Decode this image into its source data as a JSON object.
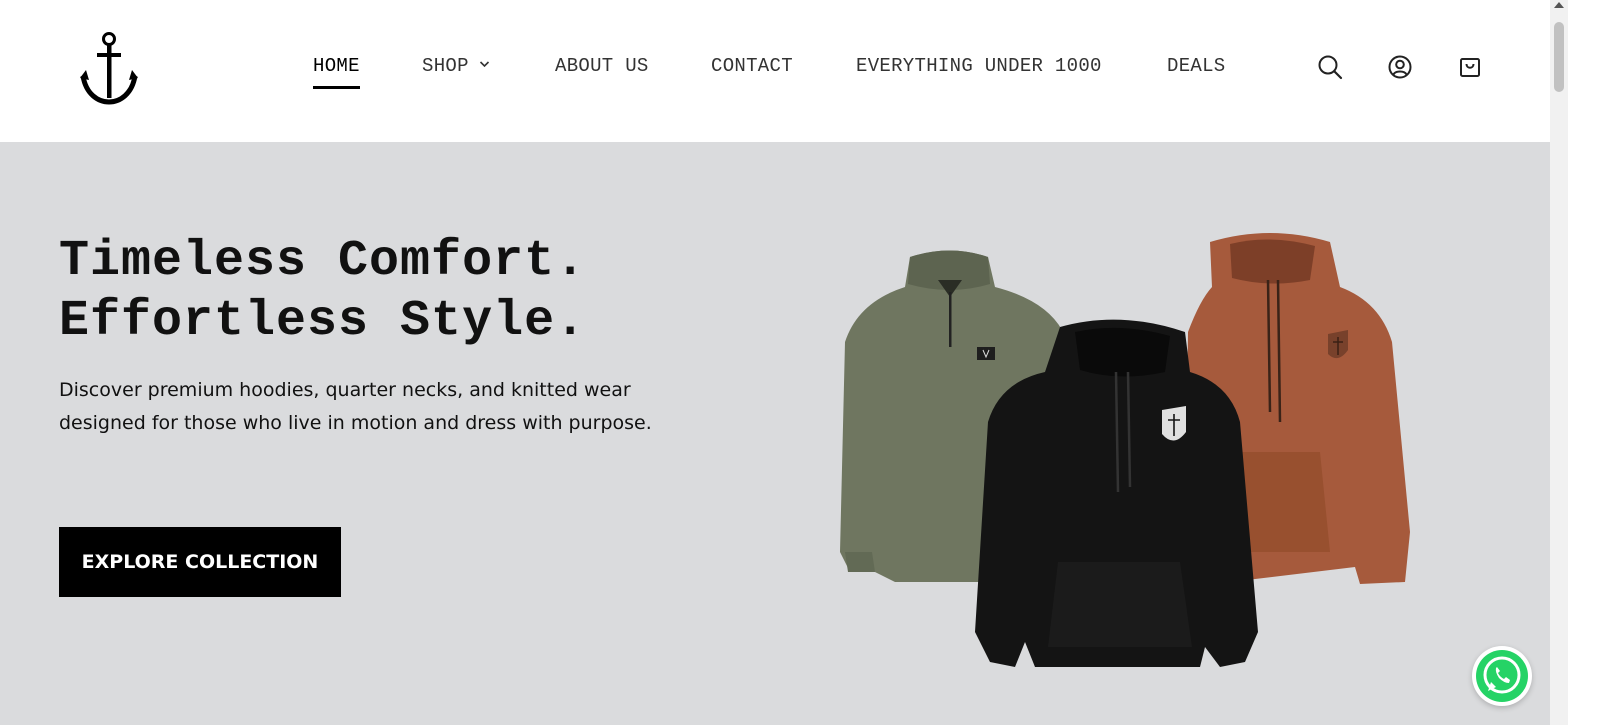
{
  "nav": {
    "items": [
      {
        "label": "HOME",
        "active": true
      },
      {
        "label": "SHOP",
        "has_dropdown": true
      },
      {
        "label": "ABOUT US"
      },
      {
        "label": "CONTACT"
      },
      {
        "label": "EVERYTHING UNDER 1000"
      },
      {
        "label": "DEALS"
      }
    ]
  },
  "header_icons": [
    "search-icon",
    "account-icon",
    "cart-icon"
  ],
  "hero": {
    "title_line1": "Timeless Comfort.",
    "title_line2": "Effortless Style.",
    "subtitle": "Discover premium hoodies, quarter necks, and knitted wear  designed for those who live in motion and dress with purpose.",
    "cta_label": "EXPLORE COLLECTION"
  },
  "colors": {
    "hero_bg": "#dadbdd",
    "cta_bg": "#000000",
    "olive": "#6f7660",
    "black_hoodie": "#141414",
    "rust": "#a65a3c",
    "whatsapp": "#25d366"
  }
}
